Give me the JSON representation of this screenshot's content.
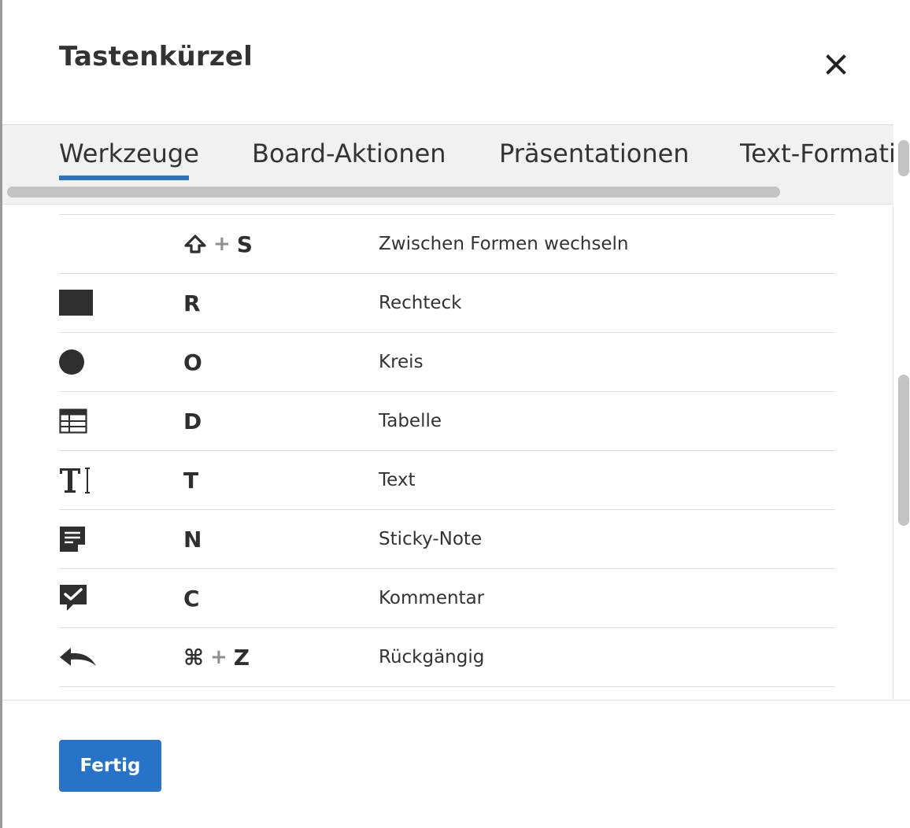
{
  "dialog": {
    "title": "Tastenkürzel",
    "close_icon": "close-icon",
    "done_label": "Fertig"
  },
  "tabs": [
    {
      "label": "Werkzeuge",
      "active": true
    },
    {
      "label": "Board-Aktionen",
      "active": false
    },
    {
      "label": "Präsentationen",
      "active": false
    },
    {
      "label": "Text-Formatie",
      "active": false
    }
  ],
  "shortcuts": [
    {
      "icon": "none",
      "modifier": "⇧",
      "plus": "+",
      "key": "S",
      "label": "Zwischen Formen wechseln"
    },
    {
      "icon": "rectangle-icon",
      "modifier": "",
      "plus": "",
      "key": "R",
      "label": "Rechteck"
    },
    {
      "icon": "circle-icon",
      "modifier": "",
      "plus": "",
      "key": "O",
      "label": "Kreis"
    },
    {
      "icon": "table-icon",
      "modifier": "",
      "plus": "",
      "key": "D",
      "label": "Tabelle"
    },
    {
      "icon": "text-icon",
      "modifier": "",
      "plus": "",
      "key": "T",
      "label": "Text"
    },
    {
      "icon": "sticky-note-icon",
      "modifier": "",
      "plus": "",
      "key": "N",
      "label": "Sticky-Note"
    },
    {
      "icon": "comment-icon",
      "modifier": "",
      "plus": "",
      "key": "C",
      "label": "Kommentar"
    },
    {
      "icon": "undo-icon",
      "modifier": "⌘",
      "plus": "+",
      "key": "Z",
      "label": "Rückgängig"
    }
  ],
  "colors": {
    "accent": "#2673c8",
    "text": "#333333",
    "tabbar_bg": "#f1f1f1",
    "divider": "#dcdcdc"
  }
}
